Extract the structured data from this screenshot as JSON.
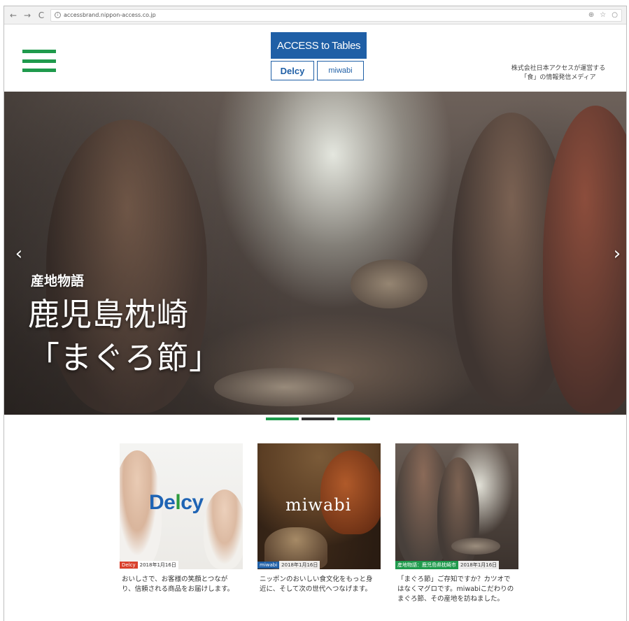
{
  "browser": {
    "url": "accessbrand.nippon-access.co.jp",
    "back_glyph": "←",
    "forward_glyph": "→",
    "reload_glyph": "C",
    "info_glyph": "i",
    "zoom_glyph": "⊕",
    "star_glyph": "☆",
    "ext_glyph": "○"
  },
  "header": {
    "logo_title": "ACCESS to Tables",
    "logo_delcy": "Delcy",
    "logo_miwabi": "miwabi",
    "tagline_line1": "株式会社日本アクセスが運営する",
    "tagline_line2": "「食」の情報発信メディア"
  },
  "hero": {
    "kicker": "産地物語",
    "title_line1": "鹿児島枕崎",
    "title_line2": "「まぐろ節」",
    "prev_glyph": "‹",
    "next_glyph": "›"
  },
  "indicators": [
    {
      "color": "#1f9a4c",
      "active": false
    },
    {
      "color": "#333333",
      "active": true
    },
    {
      "color": "#1f9a4c",
      "active": false
    }
  ],
  "cards": [
    {
      "tag": "Delcy",
      "tag_color": "#d9402b",
      "date": "2018年1月16日",
      "image_word": "Delcy",
      "text": "おいしさで、お客様の笑顔とつながり、信頼される商品をお届けします。"
    },
    {
      "tag": "miwabi",
      "tag_color": "#1f5fa6",
      "date": "2018年1月16日",
      "image_word": "miwabi",
      "text": "ニッポンのおいしい食文化をもっと身近に、そして次の世代へつなげます。"
    },
    {
      "tag": "産地物語：鹿児島県枕崎市",
      "tag_color": "#1f9a4c",
      "date": "2018年1月16日",
      "text": "「まぐろ節」ご存知ですか？カツオではなくマグロです。miwabiこだわりのまぐろ節、その産地を訪ねました。"
    }
  ],
  "colors": {
    "brand_green": "#1f9a4c",
    "brand_blue": "#1f5fa6"
  }
}
